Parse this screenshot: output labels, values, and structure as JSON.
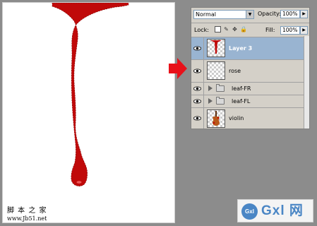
{
  "canvas": {
    "watermark_line1": "脚 本 之 家",
    "watermark_line2": "www.Jb51.net"
  },
  "colors": {
    "drip": "#c00a0a",
    "selection_bg": "#99b4d1",
    "arrow": "#e8111a",
    "panel_bg": "#d4d0c8",
    "brand": "#4a86c5"
  },
  "layers_panel": {
    "blend_mode": "Normal",
    "opacity_label": "Opacity:",
    "opacity_value": "100%",
    "lock_label": "Lock:",
    "fill_label": "Fill:",
    "fill_value": "100%",
    "layers": [
      {
        "name": "Layer 3",
        "selected": true,
        "type": "layer",
        "icon": "drip-thumbnail"
      },
      {
        "name": "rose",
        "selected": false,
        "type": "layer",
        "icon": "transparent-thumbnail"
      },
      {
        "name": "leaf-FR",
        "selected": false,
        "type": "group",
        "icon": "folder-icon"
      },
      {
        "name": "leaf-FL",
        "selected": false,
        "type": "group",
        "icon": "folder-icon"
      },
      {
        "name": "violin",
        "selected": false,
        "type": "layer",
        "icon": "violin-thumbnail"
      }
    ]
  },
  "brand": {
    "logo_text": "Gxl",
    "text": "Gxl 网"
  }
}
